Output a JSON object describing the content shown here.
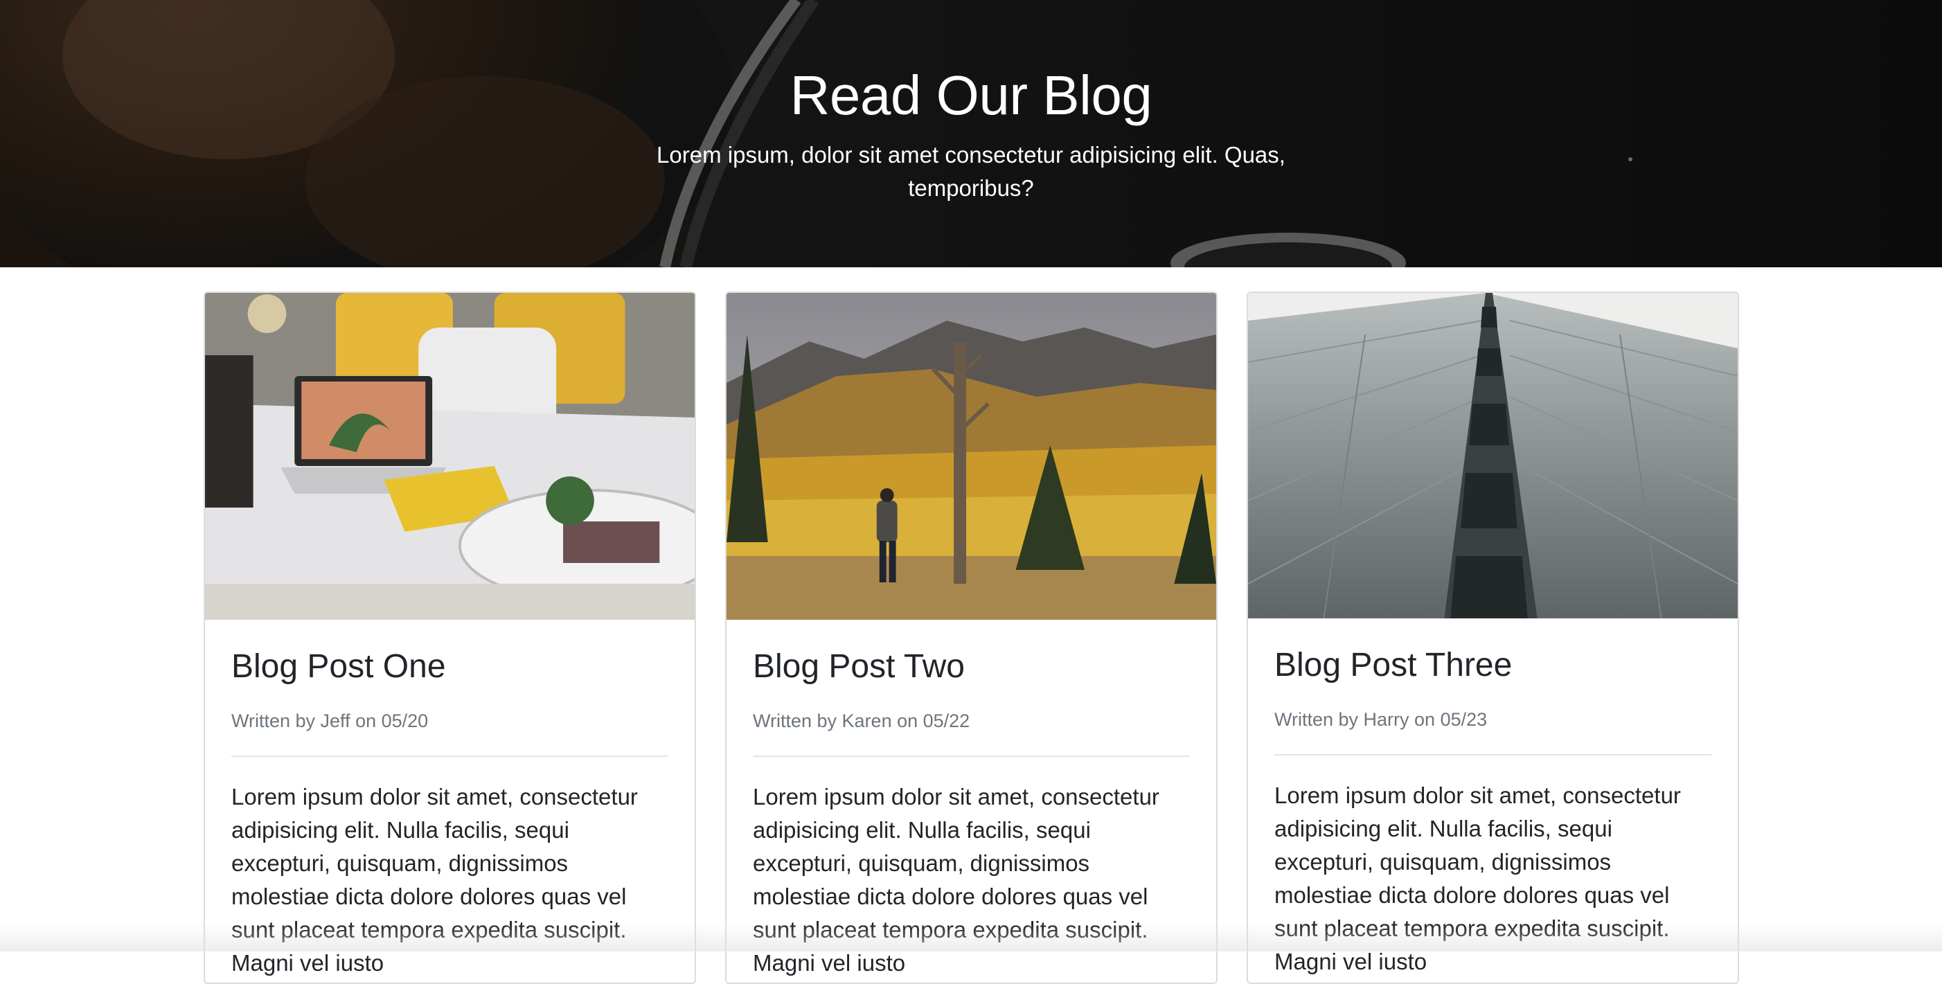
{
  "hero": {
    "title": "Read Our Blog",
    "subtitle": "Lorem ipsum, dolor sit amet consectetur adipisicing elit. Quas, temporibus?"
  },
  "posts": [
    {
      "title": "Blog Post One",
      "meta": "Written by Jeff on 05/20",
      "body": "Lorem ipsum dolor sit amet, consectetur adipisicing elit. Nulla facilis, sequi excepturi, quisquam, dignissimos molestiae dicta dolore dolores quas vel sunt placeat tempora expedita suscipit. Magni vel iusto",
      "image": "bedroom-laptop-photo"
    },
    {
      "title": "Blog Post Two",
      "meta": "Written by Karen on 05/22",
      "body": "Lorem ipsum dolor sit amet, consectetur adipisicing elit. Nulla facilis, sequi excepturi, quisquam, dignissimos molestiae dicta dolore dolores quas vel sunt placeat tempora expedita suscipit. Magni vel iusto",
      "image": "autumn-forest-hiker-photo"
    },
    {
      "title": "Blog Post Three",
      "meta": "Written by Harry on 05/23",
      "body": "Lorem ipsum dolor sit amet, consectetur adipisicing elit. Nulla facilis, sequi excepturi, quisquam, dignissimos molestiae dicta dolore dolores quas vel sunt placeat tempora expedita suscipit. Magni vel iusto",
      "image": "skyscraper-facade-photo"
    }
  ],
  "colors": {
    "hero_bg": "#0d0d0d",
    "title_text": "#212529",
    "meta_text": "#6c757d",
    "card_border": "#dcdcdc"
  }
}
